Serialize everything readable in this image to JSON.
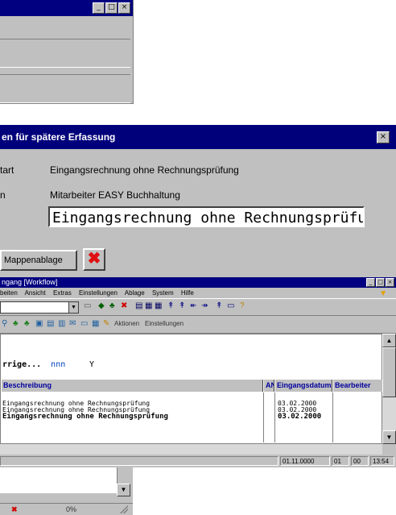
{
  "bg_window": {
    "minimize": "_",
    "maximize": "□",
    "close": "×"
  },
  "dialog": {
    "title": "en für spätere Erfassung",
    "close": "×",
    "rows": [
      {
        "label": "tart",
        "value": "Eingangsrechnung ohne Rechnungsprüfung"
      },
      {
        "label": "n",
        "value": "Mitarbeiter EASY Buchhaltung"
      }
    ],
    "name_field": "Eingangsrechnung ohne Rechnungsprüfung",
    "button_label": "Mappenablage",
    "cancel_icon": "✖"
  },
  "app": {
    "title": "ngang   [Workflow]",
    "menu": [
      "beiten",
      "Ansicht",
      "Extras",
      "Einstellungen",
      "Ablage",
      "System",
      "Hilfe"
    ],
    "toolbar2_label1": "Aktionen",
    "toolbar2_label2": "Einstellungen",
    "filter_label": "rrige...",
    "filter_value": "nnn",
    "filter_marker": "Y",
    "columns": [
      "Beschreibung",
      "AN",
      "Eingangsdatum",
      "Bearbeiter"
    ],
    "rows": [
      {
        "desc": "Eingangsrechnung ohne Rechnungsprüfung",
        "date": "03.02.2000"
      },
      {
        "desc": "Eingangsrechnung ohne Rechnungsprüfung",
        "date": "03.02.2000"
      },
      {
        "desc": "Eingangsrechnung ohne Rechnungsprüfung",
        "date": "03.02.2000"
      }
    ],
    "status": [
      "",
      "01.11.0000",
      "01",
      "00",
      "13:54"
    ]
  },
  "bottom": {
    "cancel_mark": "✖",
    "count": "0%"
  }
}
